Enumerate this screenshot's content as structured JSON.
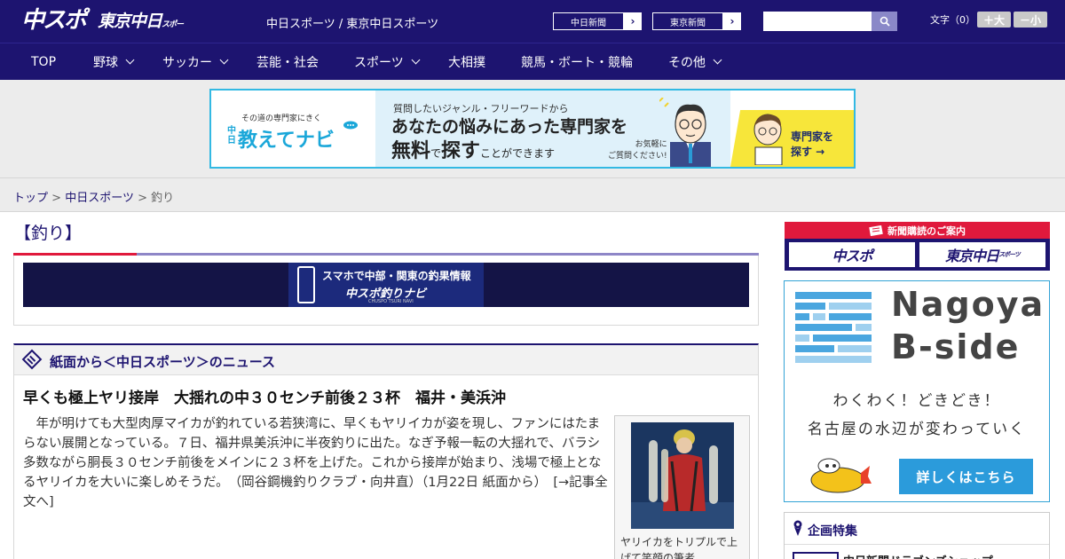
{
  "header": {
    "logo_chuspo": "中スポ",
    "logo_tokyo": "東京中日",
    "logo_tokyo_small": "スポーツ",
    "site_links": "中日スポーツ / 東京中日スポーツ",
    "ext_buttons": [
      "中日新聞",
      "東京新聞"
    ],
    "search_placeholder": "",
    "fontsize_label": "文字（0）",
    "fontsize_up": "＋大",
    "fontsize_down": "－小"
  },
  "nav": {
    "items": [
      {
        "label": "TOP",
        "has_dropdown": false
      },
      {
        "label": "野球",
        "has_dropdown": true
      },
      {
        "label": "サッカー",
        "has_dropdown": true
      },
      {
        "label": "芸能・社会",
        "has_dropdown": false
      },
      {
        "label": "スポーツ",
        "has_dropdown": true
      },
      {
        "label": "大相撲",
        "has_dropdown": false
      },
      {
        "label": "競馬・ボート・競輪",
        "has_dropdown": false
      },
      {
        "label": "その他",
        "has_dropdown": true
      }
    ]
  },
  "ad": {
    "tagline": "その道の専門家にきく",
    "brand_prefix": "中日",
    "brand": "教えてナビ",
    "line1": "質問したいジャンル・フリーワードから",
    "line2": "あなたの悩みにあった専門家を",
    "line3_main": "無料",
    "line3_mid": "で",
    "line3_bold": "探す",
    "line3_tail": "ことができます",
    "note": "お気軽に\nご質問ください!",
    "cta": "専門家を\n探す →"
  },
  "breadcrumb": {
    "items": [
      "トップ",
      "中日スポーツ"
    ],
    "separator": ">",
    "current": "釣り"
  },
  "page": {
    "heading": "【釣り】"
  },
  "navi_banner": {
    "line1": "スマホで中部・関東の釣果情報",
    "line2": "中スポ釣りナビ",
    "line3": "CHUSPO TSURI NAVI"
  },
  "news": {
    "section_title": "紙面から＜中日スポーツ＞のニュース",
    "article_title": "早くも極上ヤリ接岸　大揺れの中３０センチ前後２３杯　福井・美浜沖",
    "article_body": "年が明けても大型肉厚マイカが釣れている若狭湾に、早くもヤリイカが姿を現し、ファンにはたまらない展開となっている。７日、福井県美浜沖に半夜釣りに出た。なぎ予報一転の大揺れで、バラシ多数ながら胴長３０センチ前後をメインに２３杯を上げた。これから接岸が始まり、浅場で極上となるヤリイカを大いに楽しめそうだ。　（岡谷鋼機釣りクラブ・向井直）（1月22日 紙面から）　[→記事全文へ]",
    "photo_caption": "ヤリイカをトリプルで上げて笑顔の筆者"
  },
  "sidebar": {
    "subscribe_title": "新聞購読のご案内",
    "subscribe_logos": [
      "中スポ",
      "東京中日"
    ],
    "subscribe_logo_small": "スポーツ",
    "nagoya_line1": "Nagoya",
    "nagoya_line2": "B-side",
    "nagoya_catch1": "わくわく！どきどき！",
    "nagoya_catch2": "名古屋の水辺が変わっていく",
    "nagoya_button": "詳しくはこちら",
    "feature_title": "企画特集",
    "feature_item": "中日新聞ドラゴンズショップ"
  },
  "colors": {
    "brand_navy": "#1d1470",
    "accent_red": "#e0193c",
    "ad_border": "#33b9e3",
    "button_blue": "#2b9bdb"
  }
}
